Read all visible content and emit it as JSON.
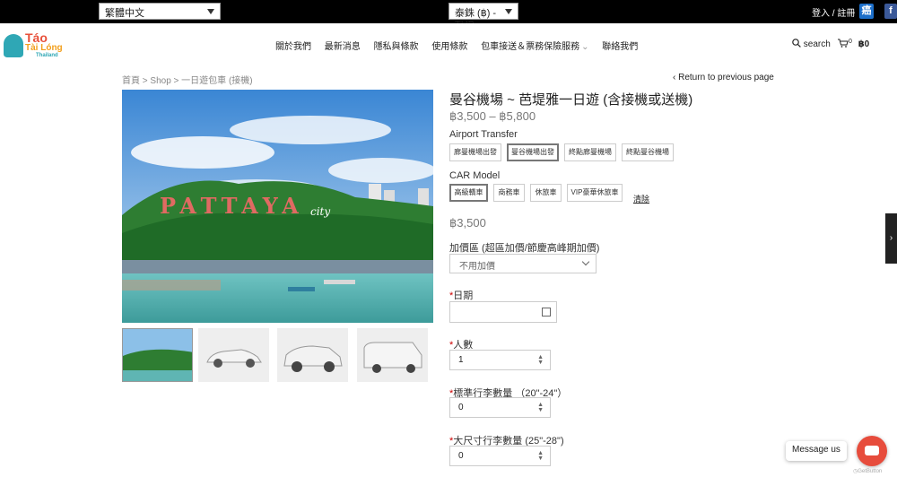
{
  "topbar": {
    "language": "繁體中文",
    "currency": "泰銖 (฿) - THB",
    "login": "登入 / 註冊",
    "social_a": "癌",
    "social_b": "f"
  },
  "logo": {
    "line1": "Táo",
    "line2": "Tài Lóng",
    "line3": "Thailand"
  },
  "nav": [
    "關於我們",
    "最新消息",
    "隱私與條款",
    "使用條款",
    "包車接送＆票務保險服務",
    "聯絡我們"
  ],
  "nav_dropdown_glyph": "⌄",
  "search_label": "search",
  "cart": {
    "count": "0",
    "total": "฿0"
  },
  "breadcrumb": {
    "home": "首頁",
    "shop": "Shop",
    "current": "一日遊包車 (接機)",
    "sep": ">"
  },
  "return_link": "Return to previous page",
  "gallery": {
    "sign": "PATTAYA",
    "sign_city": "city",
    "thumbs": [
      "pattaya-thumb",
      "sedan",
      "suv",
      "van"
    ]
  },
  "product": {
    "title": "曼谷機場 ~ 芭堤雅一日遊 (含接機或送機)",
    "price_range": "฿3,500 – ฿5,800",
    "transfer_label": "Airport Transfer",
    "transfer_options": [
      "廊曼機場出發",
      "曼谷機場出發",
      "終點廊曼機場",
      "終點曼谷機場"
    ],
    "transfer_selected": 1,
    "car_label": "CAR Model",
    "car_options": [
      "高級轎車",
      "商務車",
      "休旅車",
      "VIP豪華休旅車"
    ],
    "car_selected": 0,
    "clear_label": "清除",
    "price": "฿3,500",
    "surcharge_label": "加價區 (超區加價/節慶高峰期加價)",
    "surcharge_value": "不用加價",
    "date_label": "日期",
    "people_label": "人數",
    "people_value": "1",
    "std_luggage_label": "標準行李數量 （20\"-24\"）",
    "std_luggage_value": "0",
    "large_luggage_label": "大尺寸行李數量 (25\"-28\")",
    "large_luggage_value": "0",
    "required_mark": "*"
  },
  "chat": {
    "bubble": "Message us",
    "powered": "GetButton"
  },
  "side_tab_glyph": "›"
}
